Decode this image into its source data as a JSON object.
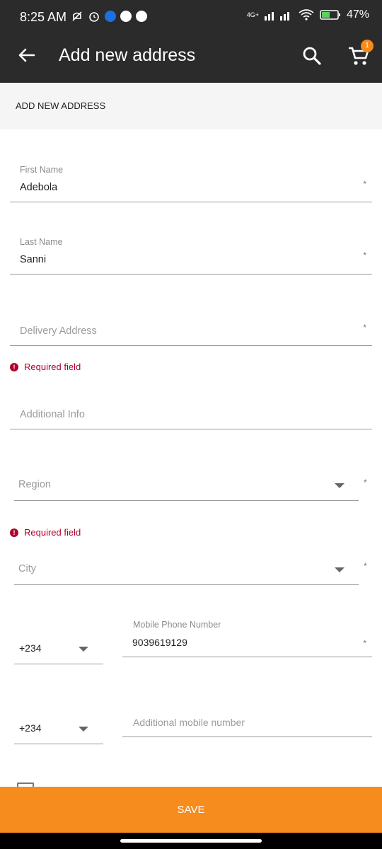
{
  "status_bar": {
    "time": "8:25 AM",
    "battery": "47%",
    "network": "4G+"
  },
  "app_bar": {
    "title": "Add new address",
    "cart_count": "1",
    "accent_color": "#f68b1e",
    "background_color": "#2b2b2b"
  },
  "section": {
    "title": "ADD NEW ADDRESS"
  },
  "form": {
    "first_name": {
      "label": "First Name",
      "value": "Adebola",
      "required_mark": "*"
    },
    "last_name": {
      "label": "Last Name",
      "value": "Sanni",
      "required_mark": "*"
    },
    "delivery_address": {
      "placeholder": "Delivery Address",
      "required_mark": "*",
      "error": "Required field"
    },
    "additional_info": {
      "placeholder": "Additional Info"
    },
    "region": {
      "placeholder": "Region",
      "required_mark": "*",
      "error": "Required field"
    },
    "city": {
      "placeholder": "City",
      "required_mark": "*"
    },
    "mobile_phone": {
      "country_code": "+234",
      "label": "Mobile Phone Number",
      "value": "9039619129",
      "required_mark": "*"
    },
    "additional_mobile": {
      "country_code": "+234",
      "placeholder": "Additional mobile number"
    }
  },
  "actions": {
    "save_label": "SAVE"
  },
  "icons": {
    "back": "arrow-left-icon",
    "search": "search-icon",
    "cart": "cart-icon",
    "error": "error-icon",
    "dropdown": "chevron-down-icon"
  },
  "colors": {
    "error": "#b0002b",
    "save_button": "#f68b1e"
  }
}
